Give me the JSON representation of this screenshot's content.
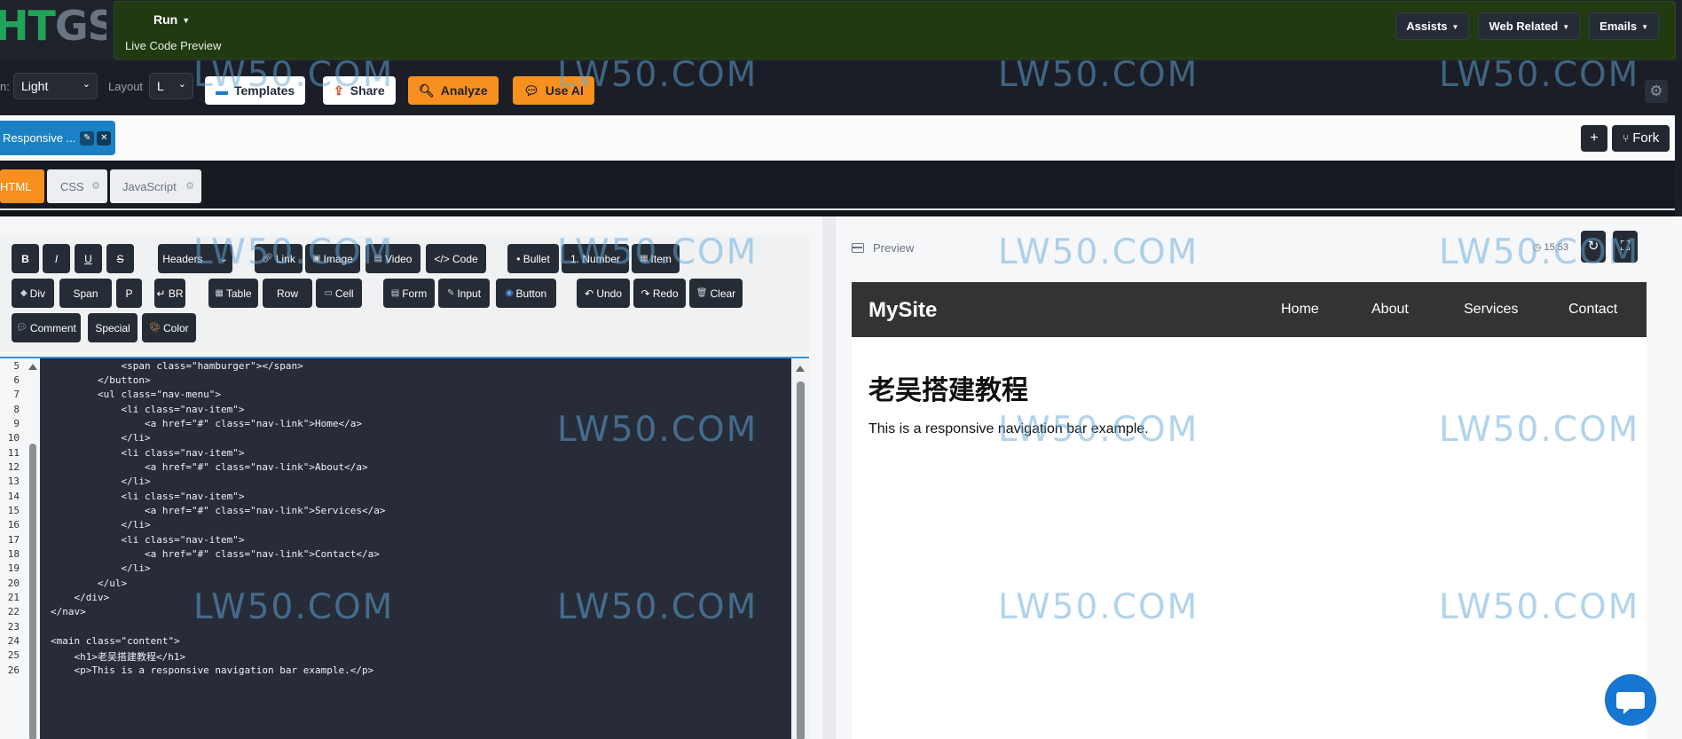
{
  "header": {
    "logo_text_green": "HT",
    "logo_text_gray": "GS",
    "run_label": "Run",
    "live_preview_label": "Live Code Preview",
    "menus": [
      "Assists",
      "Web Related",
      "Emails"
    ]
  },
  "toolbar": {
    "theme_label": "n:",
    "theme_value": "Light",
    "layout_label": "Layout",
    "layout_value": "L",
    "templates_label": "Templates",
    "share_label": "Share",
    "analyze_label": "Analyze",
    "use_ai_label": "Use AI"
  },
  "file_tab": {
    "name": "Responsive ...",
    "plus_label": "+",
    "fork_label": "Fork"
  },
  "language_tabs": [
    "HTML",
    "CSS",
    "JavaScript"
  ],
  "format_buttons": {
    "row1": [
      "B",
      "I",
      "U",
      "S",
      "Headers",
      "Link",
      "Image",
      "Video",
      "</> Code",
      "• Bullet",
      "1. Number",
      "Item"
    ],
    "row2": [
      "Div",
      "Span",
      "P",
      "↵ BR",
      "Table",
      "Row",
      "Cell",
      "Form",
      "Input",
      "Button",
      "↶ Undo",
      "↷ Redo",
      "Clear"
    ],
    "row3": [
      "Comment",
      "Special",
      "Color"
    ]
  },
  "code": {
    "line_numbers": [
      "5",
      "6",
      "7",
      "8",
      "9",
      "10",
      "11",
      "12",
      "13",
      "14",
      "15",
      "16",
      "17",
      "18",
      "19",
      "20",
      "21",
      "22",
      "23",
      "24",
      "25",
      "26"
    ],
    "lines": [
      "            <span class=\"hamburger\"></span>",
      "        </button>",
      "        <ul class=\"nav-menu\">",
      "            <li class=\"nav-item\">",
      "                <a href=\"#\" class=\"nav-link\">Home</a>",
      "            </li>",
      "            <li class=\"nav-item\">",
      "                <a href=\"#\" class=\"nav-link\">About</a>",
      "            </li>",
      "            <li class=\"nav-item\">",
      "                <a href=\"#\" class=\"nav-link\">Services</a>",
      "            </li>",
      "            <li class=\"nav-item\">",
      "                <a href=\"#\" class=\"nav-link\">Contact</a>",
      "            </li>",
      "        </ul>",
      "    </div>",
      "</nav>",
      "",
      "<main class=\"content\">",
      "    <h1>老吴搭建教程</h1>",
      "    <p>This is a responsive navigation bar example.</p>"
    ]
  },
  "preview": {
    "label": "Preview",
    "time": "15:53",
    "site_brand": "MySite",
    "nav_links": [
      "Home",
      "About",
      "Services",
      "Contact"
    ],
    "heading": "老吴搭建教程",
    "paragraph": "This is a responsive navigation bar example."
  },
  "watermark": "LW50.COM",
  "colors": {
    "accent_orange": "#f7901e",
    "tab_blue": "#1a82c4",
    "run_panel_green": "#213a12",
    "editor_bg": "#272c38"
  }
}
